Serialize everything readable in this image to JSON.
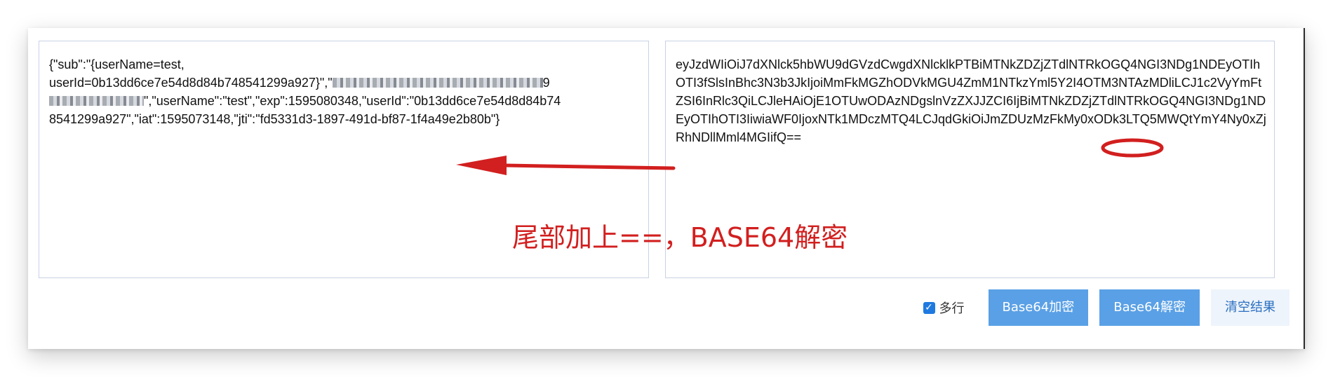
{
  "left_panel": {
    "line1": "{\"sub\":\"{userName=test,",
    "line2_a": "userId=0b13dd6ce7e54d8d84b748541299a927}\",\"",
    "line2_b": "9",
    "line3_b": "\",\"userName\":\"test\",\"exp\":1595080348,\"userId\":\"0b13dd6ce7e54d8d84b74",
    "line4": "8541299a927\",\"iat\":1595073148,\"jti\":\"fd5331d3-1897-491d-bf87-1f4a49e2b80b\"}"
  },
  "right_panel": {
    "text": "eyJzdWIiOiJ7dXNlck5hbWU9dGVzdCwgdXNlcklkPTBiMTNkZDZjZTdlNTRkOGQ4NGI3NDg1NDEyOTIhOTI3fSlsInBhc3N3b3JkIjoiMmFkMGZhODVkMGU4ZmM1NTkzYml5Y2I4OTM3NTAzMDliLCJ1c2VyYmFtZSI6InRlc3QiLCJleHAiOjE1OTUwODAzNDgslnVzZXJJZCI6IjBiMTNkZDZjZTdlNTRkOGQ4NGI3NDg1NDEyOTIhOTI3IiwiaWF0IjoxNTk1MDczMTQ4LCJqdGkiOiJmZDUzMzFkMy0xODk3LTQ5MWQtYmY4Ny0xZjRhNDllMml4MGIifQ=="
  },
  "annotation": {
    "text": "尾部加上==，BASE64解密",
    "color": "#d21f1f"
  },
  "toolbar": {
    "multiline_label": "多行",
    "multiline_checked": true,
    "encode_label": "Base64加密",
    "decode_label": "Base64解密",
    "clear_label": "清空结果",
    "primary_color": "#5aa0e6"
  }
}
